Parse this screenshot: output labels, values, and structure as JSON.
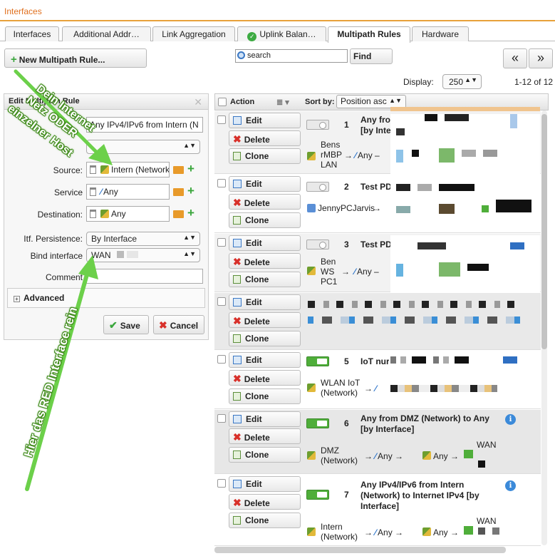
{
  "window": {
    "title": "Interfaces"
  },
  "tabs": [
    {
      "label": "Interfaces",
      "active": false
    },
    {
      "label": "Additional Addr…",
      "active": false
    },
    {
      "label": "Link Aggregation",
      "active": false
    },
    {
      "label": "Uplink Balan…",
      "active": false
    },
    {
      "label": "Multipath Rules",
      "active": true
    },
    {
      "label": "Hardware",
      "active": false
    }
  ],
  "toolbar": {
    "new_rule_label": "New Multipath Rule...",
    "search_value": "search",
    "find_label": "Find",
    "prev_label": "«",
    "next_label": "»"
  },
  "pager": {
    "display_label": "Display:",
    "display_value": "250",
    "count": "1-12 of 12"
  },
  "edit_panel": {
    "title": "Edit Multipath Rule",
    "name_value": "Any IPv4/IPv6 from Intern (N",
    "source_label": "Source:",
    "source_value": "Intern (Network)",
    "service_label": "Service",
    "service_value": "Any",
    "destination_label": "Destination:",
    "destination_value": "Any",
    "persistence_label": "Itf. Persistence:",
    "persistence_value": "By Interface",
    "bind_label": "Bind interface",
    "bind_value": "WAN",
    "comment_label": "Comment",
    "advanced_label": "Advanced",
    "save_label": "Save",
    "cancel_label": "Cancel"
  },
  "list": {
    "action_header": "Action",
    "sortby_label": "Sort by:",
    "sortby_value": "Position asc",
    "buttons": {
      "edit": "Edit",
      "delete": "Delete",
      "clone": "Clone"
    },
    "rules": [
      {
        "pos": "1",
        "title": "Any fro",
        "title2": "[by Inte",
        "source": "Bens rMBP LAN",
        "service": "Any",
        "dest": "",
        "iface": ""
      },
      {
        "pos": "2",
        "title": "Test PD",
        "title2": "",
        "source": "JennyPCJarvis",
        "service": "",
        "dest": "",
        "iface": ""
      },
      {
        "pos": "3",
        "title": "Test PD",
        "title2": "",
        "source": "Ben WS PC1",
        "service": "Any",
        "dest": "",
        "iface": ""
      },
      {
        "pos": "",
        "title": "",
        "title2": "",
        "source": "",
        "service": "",
        "dest": "",
        "iface": ""
      },
      {
        "pos": "5",
        "title": "IoT nur",
        "title2": "",
        "source": "WLAN IoT (Network)",
        "service": "",
        "dest": "",
        "iface": ""
      },
      {
        "pos": "6",
        "title": "Any from DMZ (Network) to Any",
        "title2": "[by Interface]",
        "source": "DMZ (Network)",
        "service": "Any",
        "dest": "Any",
        "iface": "WAN"
      },
      {
        "pos": "7",
        "title": "Any IPv4/IPv6 from Intern",
        "title2": "(Network) to Internet IPv4 [by",
        "title3": "Interface]",
        "source": "Intern (Network)",
        "service": "Any",
        "dest": "Any",
        "iface": "WAN"
      }
    ]
  },
  "annotations": {
    "line1": "Dein Internet",
    "line2": "Netz ODER",
    "line3": "einzelner Host",
    "line4": "Hier das RED Interface rein"
  },
  "colors": {
    "accent": "#e8a13a",
    "title": "#e0701e",
    "arrow": "#6cd04a",
    "toggle_on": "#4fae3a",
    "info": "#3b8ad9"
  }
}
